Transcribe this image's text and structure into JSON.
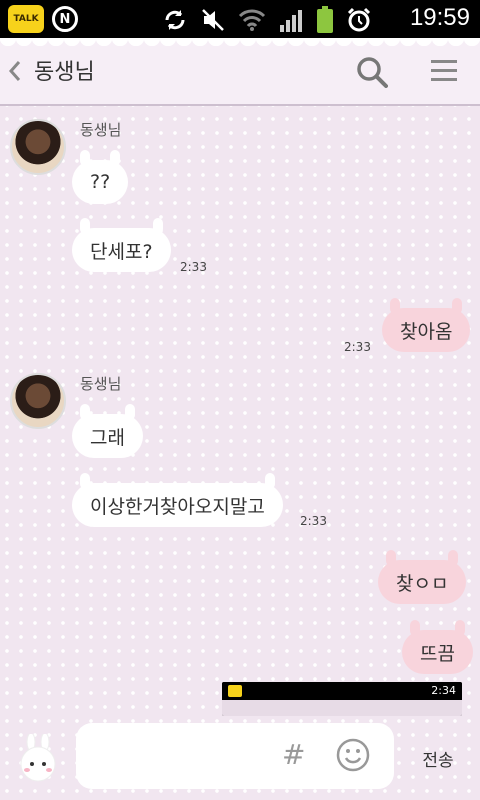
{
  "status_bar": {
    "talk_label": "TALK",
    "n_label": "N",
    "time": "19:59"
  },
  "header": {
    "title": "동생님"
  },
  "messages": [
    {
      "side": "left",
      "sender": "동생님",
      "text": "??"
    },
    {
      "side": "left",
      "text": "단세포?",
      "time": "2:33"
    },
    {
      "side": "right",
      "text": "찾아옴",
      "time": "2:33"
    },
    {
      "side": "left",
      "sender": "동생님",
      "text": "그래"
    },
    {
      "side": "left",
      "text": "이상한거찾아오지말고",
      "time": "2:33"
    },
    {
      "side": "right",
      "text": "찾ㅇㅁ"
    },
    {
      "side": "right",
      "text": "뜨끔"
    }
  ],
  "preview_thumbnail": {
    "time": "2:34"
  },
  "input": {
    "hash_label": "#",
    "send_label": "전송"
  },
  "colors": {
    "background": "#f1e6f0",
    "left_bubble": "#ffffff",
    "right_bubble": "#f8d4dc",
    "talk_yellow": "#f7d21b"
  }
}
